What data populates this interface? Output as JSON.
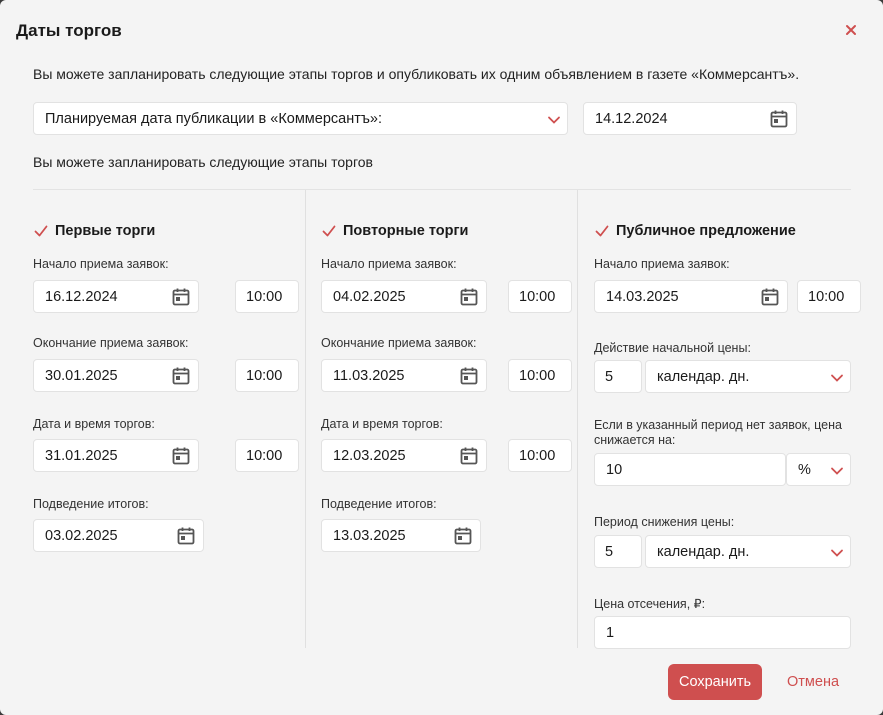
{
  "dialog": {
    "title": "Даты торгов",
    "intro": "Вы можете запланировать следующие этапы торгов и опубликовать их одним объявлением в газете «Коммерсантъ».",
    "publication_select": "Планируемая дата публикации в «Коммерсантъ»:",
    "publication_date": "14.12.2024",
    "sub_intro": "Вы можете запланировать следующие этапы торгов",
    "accent": "#cf4f4f"
  },
  "col1": {
    "title": "Первые торги",
    "start_label": "Начало приема заявок:",
    "start_date": "16.12.2024",
    "start_time": "10:00",
    "end_label": "Окончание приема заявок:",
    "end_date": "30.01.2025",
    "end_time": "10:00",
    "trade_label": "Дата и время торгов:",
    "trade_date": "31.01.2025",
    "trade_time": "10:00",
    "result_label": "Подведение итогов:",
    "result_date": "03.02.2025"
  },
  "col2": {
    "title": "Повторные торги",
    "start_label": "Начало приема заявок:",
    "start_date": "04.02.2025",
    "start_time": "10:00",
    "end_label": "Окончание приема заявок:",
    "end_date": "11.03.2025",
    "end_time": "10:00",
    "trade_label": "Дата и время торгов:",
    "trade_date": "12.03.2025",
    "trade_time": "10:00",
    "result_label": "Подведение итогов:",
    "result_date": "13.03.2025"
  },
  "col3": {
    "title": "Публичное предложение",
    "start_label": "Начало приема заявок:",
    "start_date": "14.03.2025",
    "start_time": "10:00",
    "price_action_label": "Действие начальной цены:",
    "price_action_value": "5",
    "price_action_unit": "календар. дн.",
    "decrease_label": "Если в указанный период нет заявок, цена снижается на:",
    "decrease_value": "10",
    "decrease_unit": "%",
    "period_label": "Период снижения цены:",
    "period_value": "5",
    "period_unit": "календар. дн.",
    "cutoff_label": "Цена отсечения, ₽:",
    "cutoff_value": "1"
  },
  "buttons": {
    "save": "Сохранить",
    "cancel": "Отмена"
  }
}
